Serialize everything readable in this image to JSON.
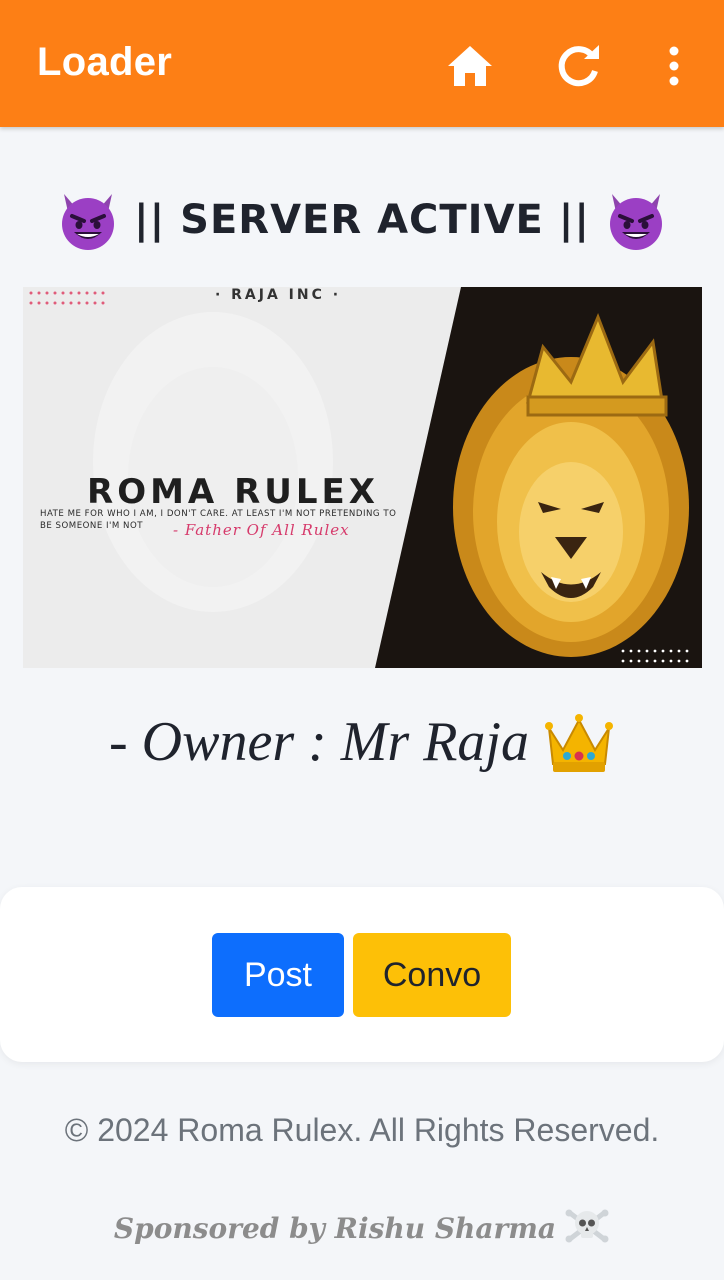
{
  "appbar": {
    "title": "Loader",
    "icons": [
      "home-icon",
      "refresh-icon",
      "more-vert-icon"
    ]
  },
  "server": {
    "title": "|| SERVER ACTIVE ||",
    "emoji": "smiling-devil-emoji"
  },
  "banner": {
    "tagline": "· RAJA INC ·",
    "brand": "ROMA RULEX",
    "quote": "HATE ME FOR WHO I AM, I DON'T CARE. AT LEAST I'M NOT PRETENDING TO BE SOMEONE I'M NOT",
    "signature": "- Father Of All Rulex"
  },
  "owner": {
    "label": "- Owner : Mr Raja",
    "emoji": "crown-emoji"
  },
  "actions": {
    "post_label": "Post",
    "convo_label": "Convo"
  },
  "footer": {
    "copyright": "© 2024 Roma Rulex. All Rights Reserved.",
    "sponsor": "Sponsored by Rishu Sharma",
    "sponsor_emoji": "skull-crossbones-emoji"
  },
  "colors": {
    "appbar": "#fd7f15",
    "post_button": "#0d6efd",
    "convo_button": "#fdc007",
    "background": "#f4f6f9"
  }
}
